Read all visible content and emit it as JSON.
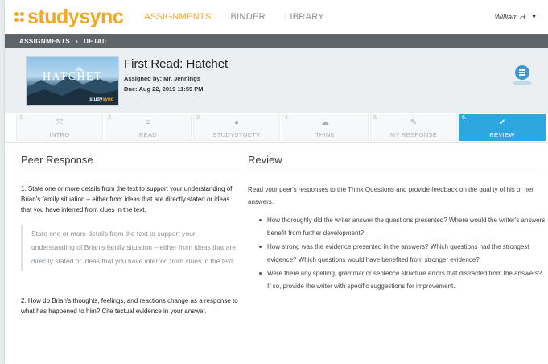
{
  "brand": {
    "part1": "study",
    "part2": "sync",
    "accent": "#f5a623"
  },
  "nav": {
    "links": [
      {
        "label": "ASSIGNMENTS",
        "active": true
      },
      {
        "label": "BINDER",
        "active": false
      },
      {
        "label": "LIBRARY",
        "active": false
      }
    ],
    "user": "William H."
  },
  "breadcrumb": {
    "part1": "ASSIGNMENTS",
    "separator": "›",
    "part2": "DETAIL"
  },
  "assignment": {
    "thumbnail_title": "HATCHET",
    "thumbnail_brand_a": "study",
    "thumbnail_brand_b": "sync",
    "title": "First Read: Hatchet",
    "assigned_by": "Assigned by: Mr. Jennings",
    "due": "Due: Aug 22, 2019 11:59 PM"
  },
  "steps": [
    {
      "num": "1.",
      "icon": "expand-icon",
      "glyph": "⤧",
      "label": "INTRO",
      "active": false
    },
    {
      "num": "2.",
      "icon": "list-icon",
      "glyph": "≡",
      "label": "READ",
      "active": false
    },
    {
      "num": "3.",
      "icon": "play-icon",
      "glyph": "●",
      "label": "STUDYSYNCTV",
      "active": false
    },
    {
      "num": "4.",
      "icon": "cloud-icon",
      "glyph": "☁",
      "label": "THINK",
      "active": false
    },
    {
      "num": "5.",
      "icon": "pencil-icon",
      "glyph": "✎",
      "label": "MY RESPONSE",
      "active": false
    },
    {
      "num": "6.",
      "icon": "check-icon",
      "glyph": "✔",
      "label": "REVIEW",
      "active": true
    }
  ],
  "peer_response": {
    "title": "Peer Response",
    "q1": "1. State one or more details from the text to support your understanding of Brian's family situation – either from ideas that are directly stated or ideas that you have inferred from clues in the text.",
    "a1": "State one or more details from the text to support your understanding of Brian's family situation – either from ideas that are directly stated or ideas that you have inferred from clues in the text.",
    "q2": "2. How do Brian's thoughts, feelings, and reactions change as a response to what has happened to him? Cite textual evidence in your answer."
  },
  "review": {
    "title": "Review",
    "intro": "Read your peer's responses to the Think Questions and provide feedback on the quality of his or her answers.",
    "bullets": [
      "How thoroughly did the writer answer the questions presented? Where would the writer's answers benefit from further development?",
      "How strong was the evidence presented in the answers? Which questions had the strongest evidence? Which questions would have benefited from stronger evidence?",
      "Were there any spelling, grammar or sentence structure errors that distracted from the answers? If so, provide the writer with specific suggestions for improvement."
    ]
  },
  "colors": {
    "accent_orange": "#f5a623",
    "active_blue": "#2ea7e0",
    "breadcrumb_bg": "#5f6469"
  }
}
